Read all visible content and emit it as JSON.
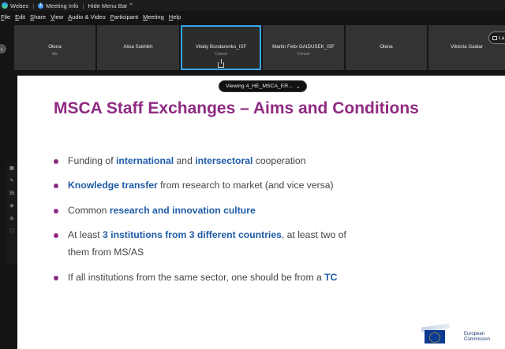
{
  "titlebar": {
    "app": "Webex",
    "meeting_info": "Meeting Info",
    "hide_menu": "Hide Menu Bar"
  },
  "menu": [
    "File",
    "Edit",
    "Share",
    "View",
    "Audio & Video",
    "Participant",
    "Meeting",
    "Help"
  ],
  "participants": [
    {
      "name": "Olena",
      "sub": "Me"
    },
    {
      "name": "Alisa Sukhikh",
      "sub": ""
    },
    {
      "name": "Vitaliy Bondarenko_ISF",
      "sub": "Cohost"
    },
    {
      "name": "Martin Felix GAIDUSEK_ISF",
      "sub": "Cohost"
    },
    {
      "name": "Olena",
      "sub": ""
    },
    {
      "name": "Viktoria Gaidar",
      "sub": ""
    }
  ],
  "layout_button": "La",
  "viewing": "Viewing 4_HE_MSCA_ER...",
  "slide": {
    "title": "MSCA Staff Exchanges – Aims and Conditions",
    "b1": {
      "t1": "Funding of ",
      "h1": "international",
      "t2": " and ",
      "h2": "intersectoral",
      "t3": " cooperation"
    },
    "b2": {
      "h1": "Knowledge transfer",
      "t1": " from research to market (and vice versa)"
    },
    "b3": {
      "t1": "Common ",
      "h1": "research and innovation culture"
    },
    "b4": {
      "t1": "At least ",
      "h1": "3 institutions from 3 different countries",
      "t2": ", at least two of",
      "line2": "them from MS/AS"
    },
    "b5": {
      "t1": "If all institutions from the same sector, one should be from a ",
      "h1": "TC"
    },
    "logo": {
      "line1": "European",
      "line2": "Commission"
    }
  },
  "toolbar": {
    "zoom_value": "35"
  },
  "colors": {
    "title": "#8f2a82",
    "highlight": "#1f5ca8",
    "active_tile": "#35a7e8"
  }
}
